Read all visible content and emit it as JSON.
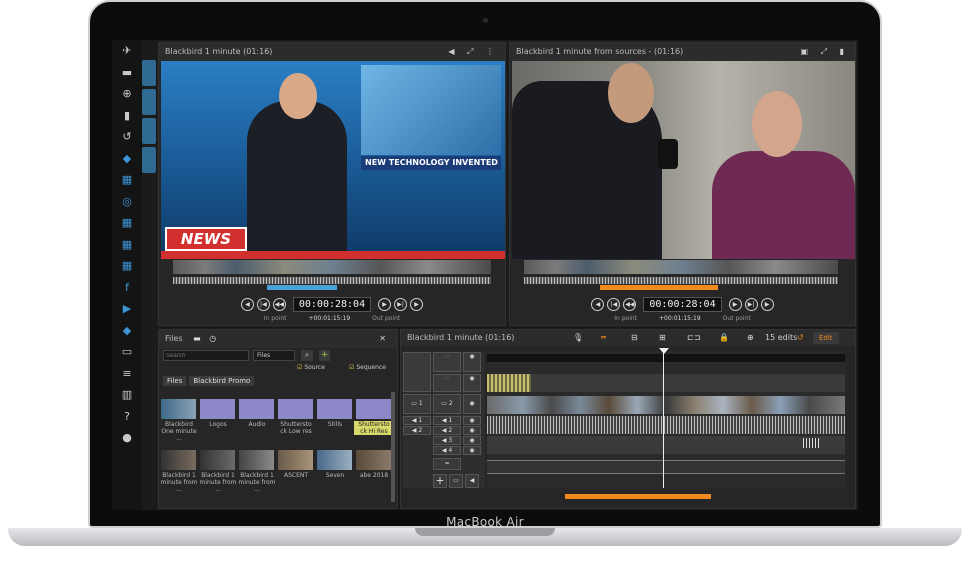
{
  "device": {
    "brand": "MacBook Air"
  },
  "left_viewer": {
    "title": "Blackbird 1 minute (01:16)",
    "timecode": "00:00:28:04",
    "in_label": "In point",
    "duration": "+00:01:15:19",
    "out_label": "Out point",
    "banner_text": "NEW TECHNOLOGY INVENTED",
    "news_text": "NEWS"
  },
  "right_viewer": {
    "title": "Blackbird 1 minute from sources - (01:16)",
    "timecode": "00:00:28:04",
    "in_label": "In point",
    "duration": "+00:01:15:19",
    "out_label": "Out point"
  },
  "files": {
    "title": "Files",
    "search_placeholder": "Search",
    "filter_value": "Files",
    "source_label": "Source",
    "sequence_label": "Sequence",
    "breadcrumb": [
      "Files",
      "Blackbird Promo"
    ],
    "items": [
      {
        "label": "Blackbird One minute ..."
      },
      {
        "label": "Logos"
      },
      {
        "label": "Audio"
      },
      {
        "label": "Shuttersto ck Low res"
      },
      {
        "label": "Stills"
      },
      {
        "label": "Shuttersto ck Hi Res"
      },
      {
        "label": "Blackbird 1 minute from ..."
      },
      {
        "label": "Blackbird 1 minute from ..."
      },
      {
        "label": "Blackbird 1 minute from ..."
      },
      {
        "label": "ASCENT"
      },
      {
        "label": "Seven"
      },
      {
        "label": "abe 2018"
      }
    ]
  },
  "timeline": {
    "title": "Blackbird 1 minute (01:16)",
    "edits": "15 edits",
    "edit_button": "Edit",
    "track_numbers": [
      "1",
      "2",
      "1",
      "2",
      "3",
      "4"
    ]
  },
  "colors": {
    "accent": "#f08a1f",
    "blue": "#3d95d6"
  }
}
